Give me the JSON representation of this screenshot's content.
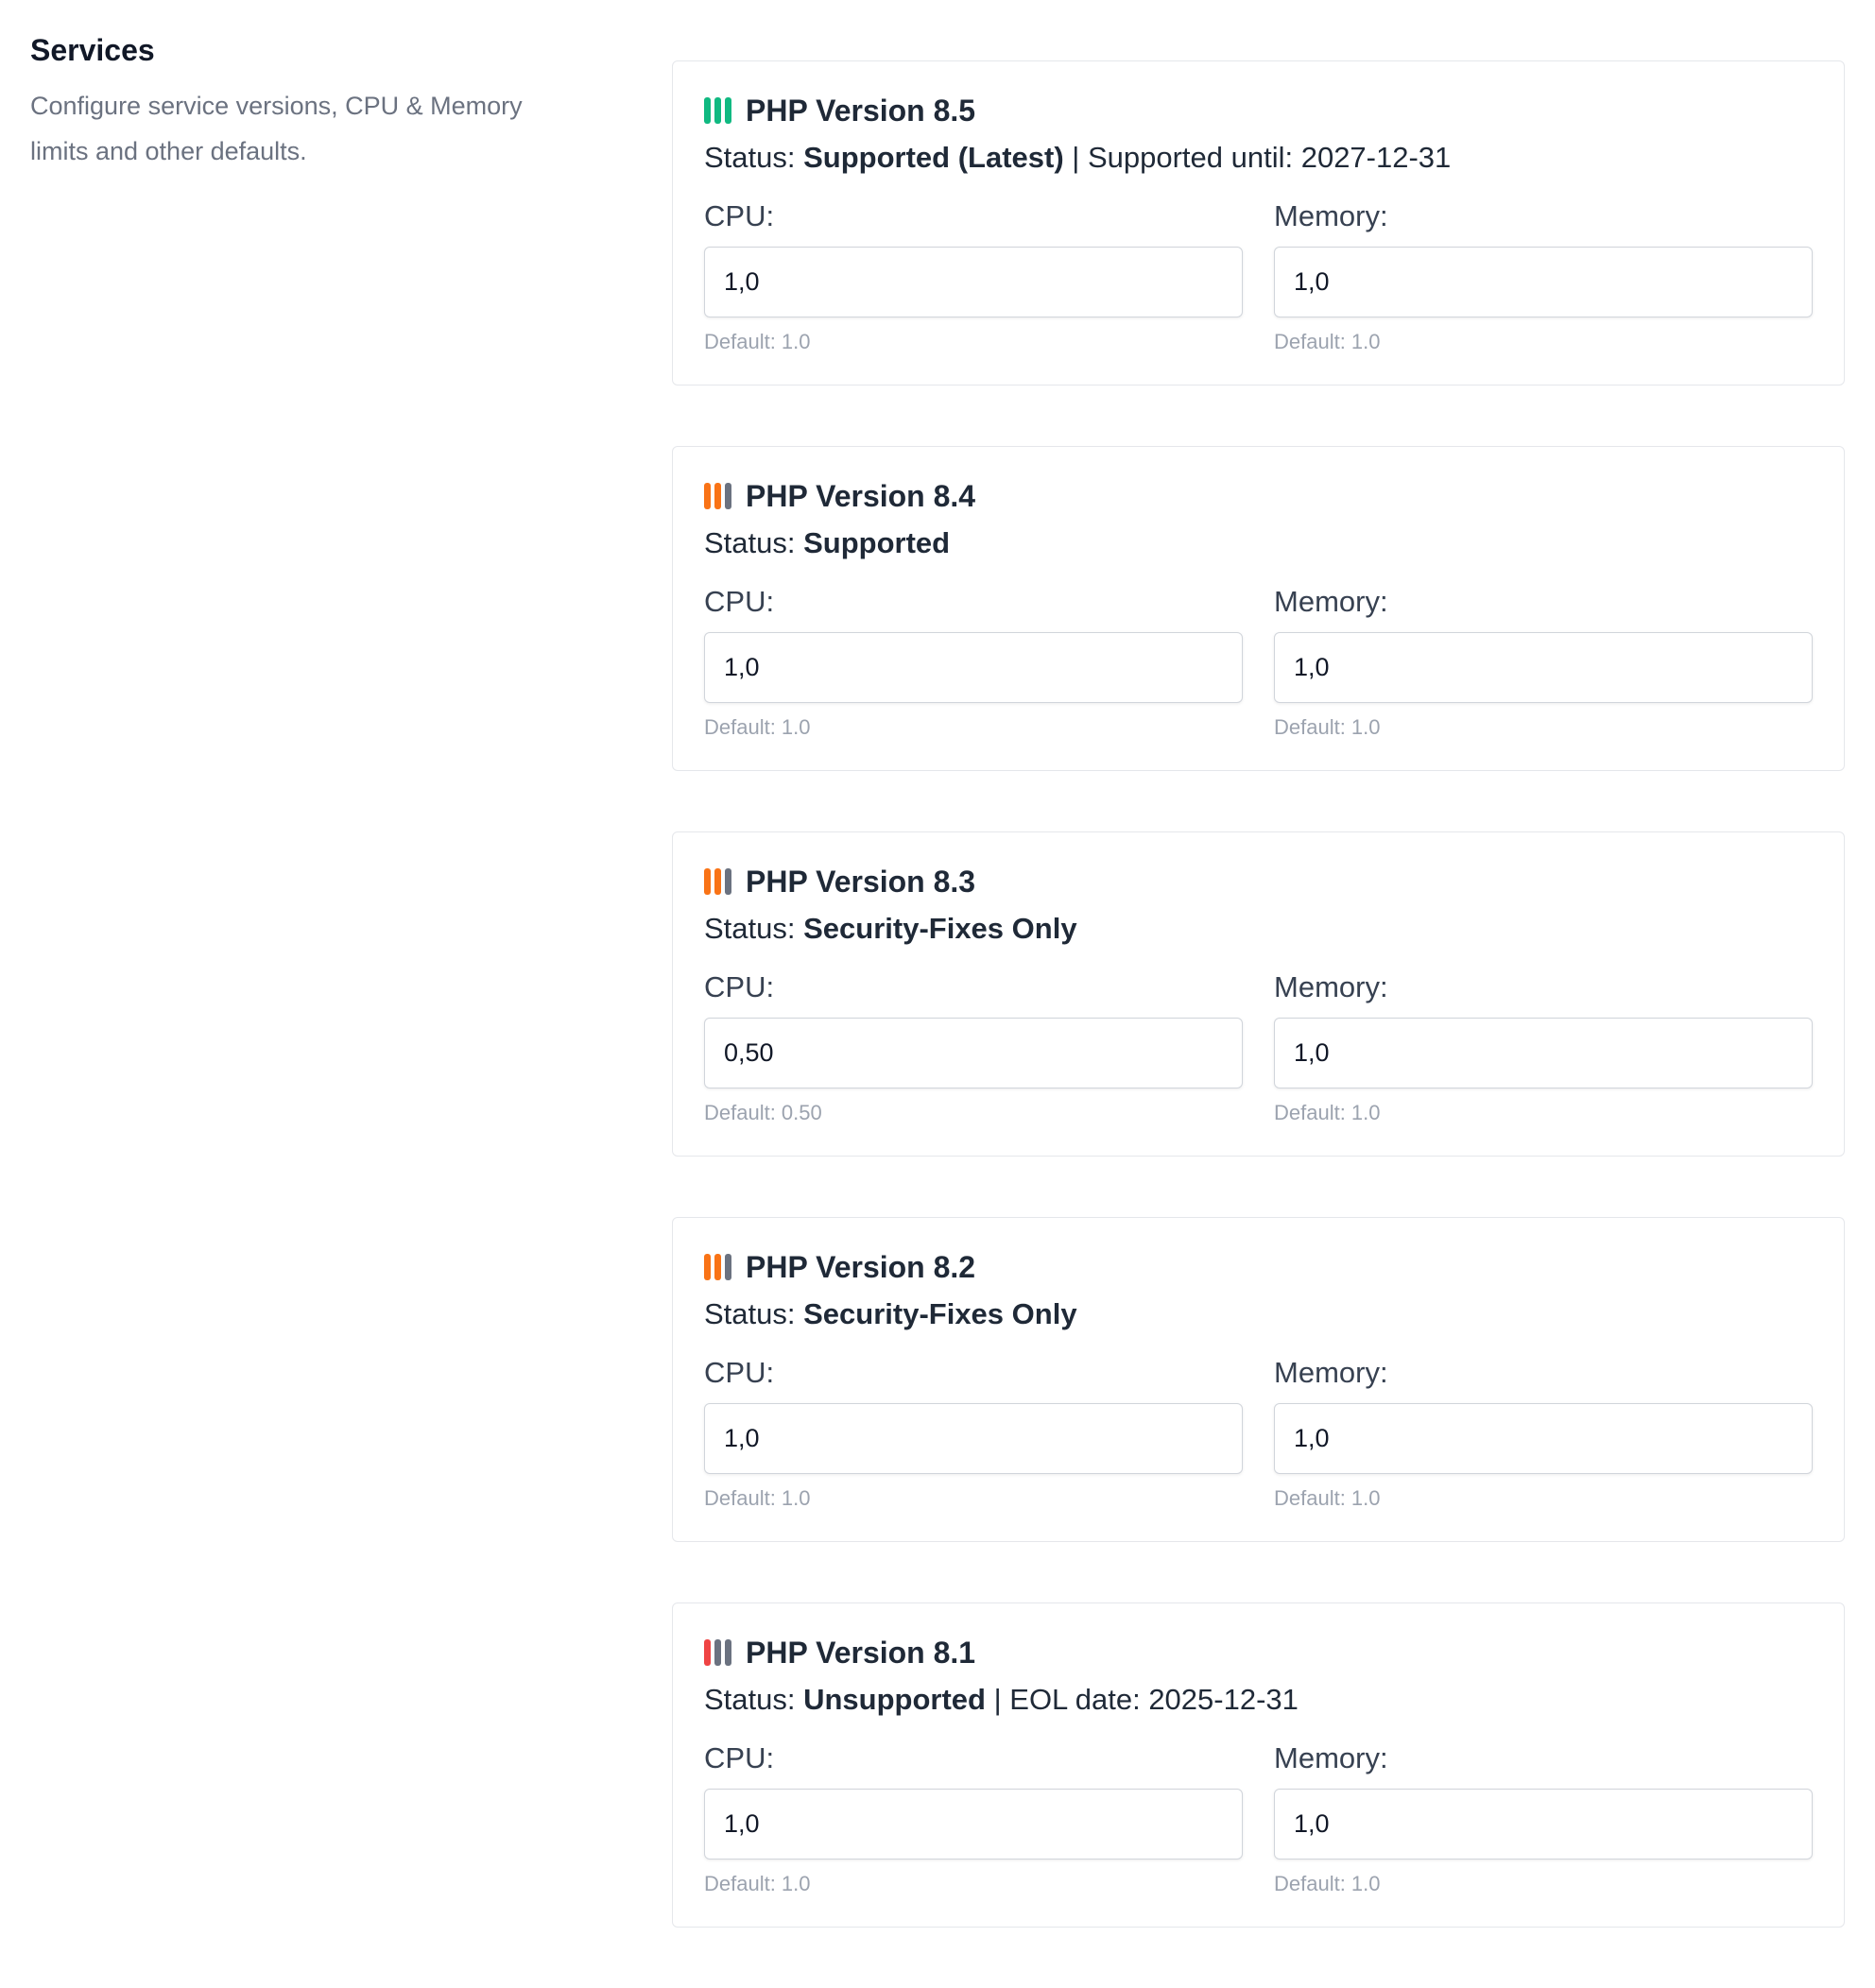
{
  "section": {
    "title": "Services",
    "description": "Configure service versions, CPU & Memory limits and other defaults."
  },
  "cards": [
    {
      "title": "PHP Version 8.5",
      "status_prefix": "Status: ",
      "status": "Supported (Latest)",
      "status_suffix": " | Supported until: 2027-12-31",
      "bar_colors": [
        "#10b981",
        "#10b981",
        "#10b981"
      ],
      "cpu_label": "CPU:",
      "cpu_value": "1,0",
      "cpu_default": "Default: 1.0",
      "memory_label": "Memory:",
      "memory_value": "1,0",
      "memory_default": "Default: 1.0"
    },
    {
      "title": "PHP Version 8.4",
      "status_prefix": "Status: ",
      "status": "Supported",
      "status_suffix": "",
      "bar_colors": [
        "#f97316",
        "#f97316",
        "#6b7280"
      ],
      "cpu_label": "CPU:",
      "cpu_value": "1,0",
      "cpu_default": "Default: 1.0",
      "memory_label": "Memory:",
      "memory_value": "1,0",
      "memory_default": "Default: 1.0"
    },
    {
      "title": "PHP Version 8.3",
      "status_prefix": "Status: ",
      "status": "Security-Fixes Only",
      "status_suffix": "",
      "bar_colors": [
        "#f97316",
        "#f97316",
        "#6b7280"
      ],
      "cpu_label": "CPU:",
      "cpu_value": "0,50",
      "cpu_default": "Default: 0.50",
      "memory_label": "Memory:",
      "memory_value": "1,0",
      "memory_default": "Default: 1.0"
    },
    {
      "title": "PHP Version 8.2",
      "status_prefix": "Status: ",
      "status": "Security-Fixes Only",
      "status_suffix": "",
      "bar_colors": [
        "#f97316",
        "#f97316",
        "#6b7280"
      ],
      "cpu_label": "CPU:",
      "cpu_value": "1,0",
      "cpu_default": "Default: 1.0",
      "memory_label": "Memory:",
      "memory_value": "1,0",
      "memory_default": "Default: 1.0"
    },
    {
      "title": "PHP Version 8.1",
      "status_prefix": "Status: ",
      "status": "Unsupported",
      "status_suffix": " | EOL date: 2025-12-31",
      "bar_colors": [
        "#ef4444",
        "#6b7280",
        "#6b7280"
      ],
      "cpu_label": "CPU:",
      "cpu_value": "1,0",
      "cpu_default": "Default: 1.0",
      "memory_label": "Memory:",
      "memory_value": "1,0",
      "memory_default": "Default: 1.0"
    }
  ]
}
